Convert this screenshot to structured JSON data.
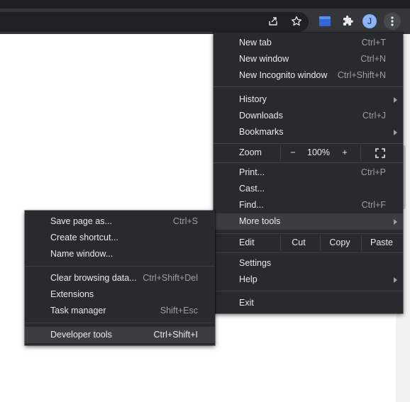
{
  "toolbar": {
    "avatar_initial": "J",
    "icons": [
      "share-icon",
      "bookmark-star-icon",
      "extension-tile-icon",
      "puzzle-extensions-icon",
      "avatar",
      "more-menu-icon"
    ]
  },
  "main_menu": {
    "new_tab": {
      "label": "New tab",
      "shortcut": "Ctrl+T"
    },
    "new_window": {
      "label": "New window",
      "shortcut": "Ctrl+N"
    },
    "new_incognito": {
      "label": "New Incognito window",
      "shortcut": "Ctrl+Shift+N"
    },
    "history": {
      "label": "History"
    },
    "downloads": {
      "label": "Downloads",
      "shortcut": "Ctrl+J"
    },
    "bookmarks": {
      "label": "Bookmarks"
    },
    "zoom": {
      "label": "Zoom",
      "minus": "−",
      "value": "100%",
      "plus": "+"
    },
    "print": {
      "label": "Print...",
      "shortcut": "Ctrl+P"
    },
    "cast": {
      "label": "Cast..."
    },
    "find": {
      "label": "Find...",
      "shortcut": "Ctrl+F"
    },
    "more_tools": {
      "label": "More tools"
    },
    "edit": {
      "label": "Edit",
      "cut": "Cut",
      "copy": "Copy",
      "paste": "Paste"
    },
    "settings": {
      "label": "Settings"
    },
    "help": {
      "label": "Help"
    },
    "exit": {
      "label": "Exit"
    }
  },
  "more_tools_menu": {
    "save_page": {
      "label": "Save page as...",
      "shortcut": "Ctrl+S"
    },
    "create_shortcut": {
      "label": "Create shortcut..."
    },
    "name_window": {
      "label": "Name window..."
    },
    "clear_browsing": {
      "label": "Clear browsing data...",
      "shortcut": "Ctrl+Shift+Del"
    },
    "extensions": {
      "label": "Extensions"
    },
    "task_manager": {
      "label": "Task manager",
      "shortcut": "Shift+Esc"
    },
    "developer_tools": {
      "label": "Developer tools",
      "shortcut": "Ctrl+Shift+I"
    }
  },
  "colors": {
    "menu_bg": "#292a2d",
    "highlight": "#3c3d41",
    "text": "#e8eaed",
    "shortcut_text": "#9aa0a6",
    "avatar_bg": "#8ab4f8",
    "extension_tile": "#3367d6"
  }
}
